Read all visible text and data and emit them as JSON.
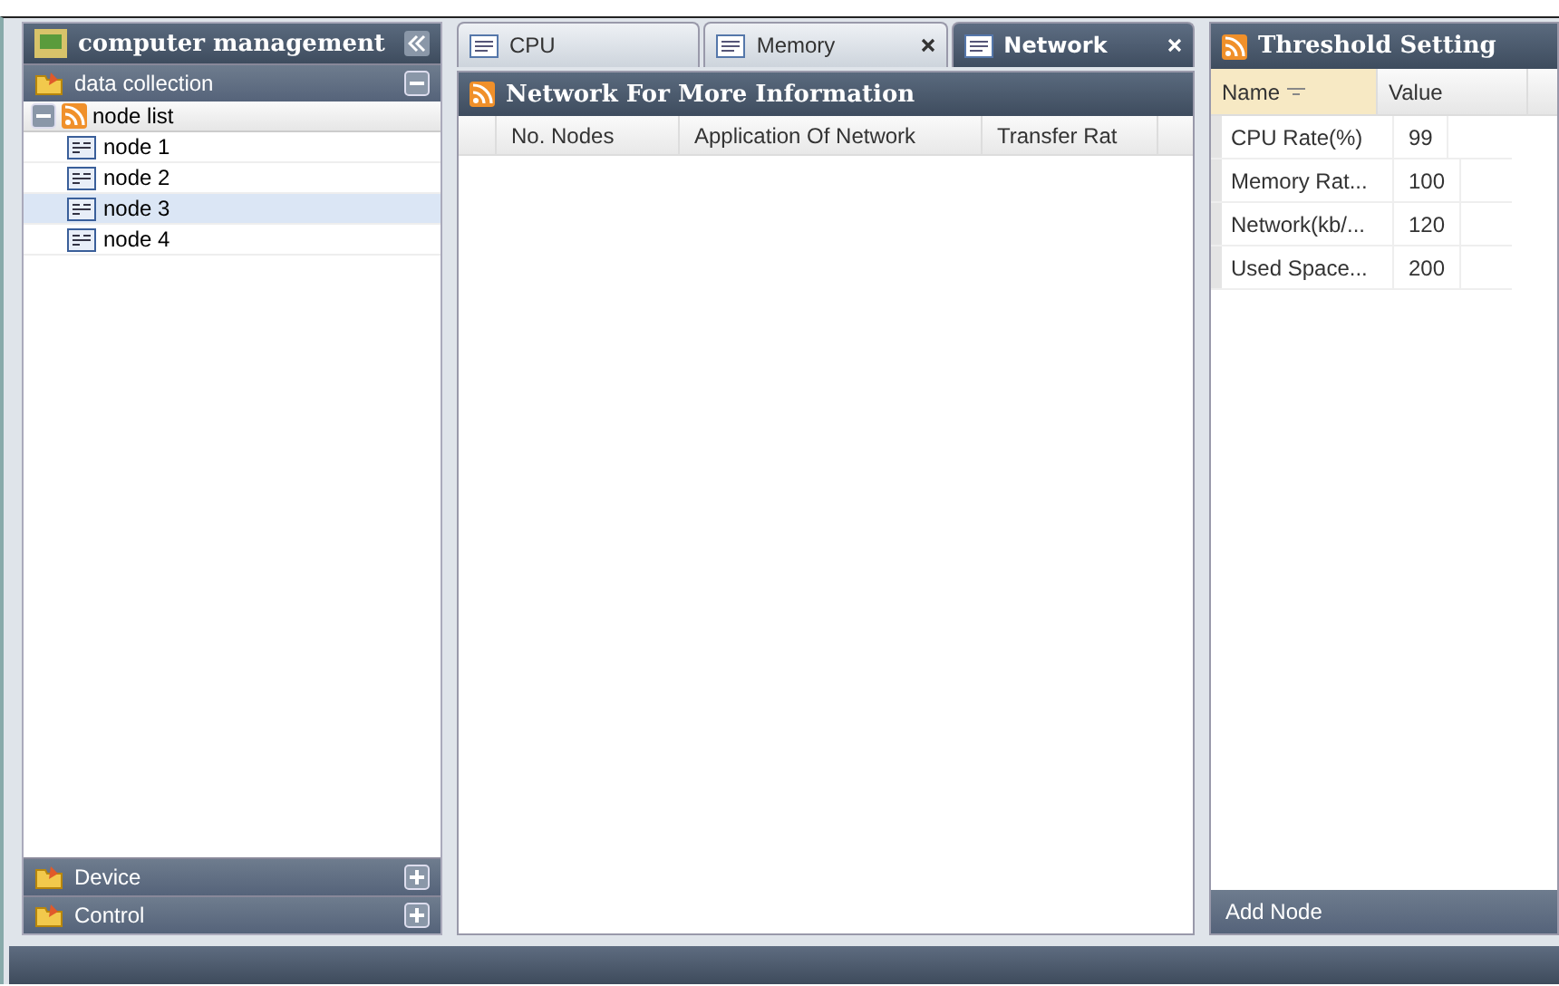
{
  "left_panel": {
    "title": "computer management",
    "sections": [
      {
        "label": "data collection",
        "expanded": true
      },
      {
        "label": "Device",
        "expanded": false
      },
      {
        "label": "Control",
        "expanded": false
      }
    ],
    "tree": {
      "label": "node list",
      "expanded": true,
      "children": [
        {
          "label": "node 1",
          "selected": false
        },
        {
          "label": "node 2",
          "selected": false
        },
        {
          "label": "node 3",
          "selected": true
        },
        {
          "label": "node 4",
          "selected": false
        }
      ]
    }
  },
  "tabs": [
    {
      "label": "CPU",
      "selected": false,
      "closable": false
    },
    {
      "label": "Memory",
      "selected": false,
      "closable": true
    },
    {
      "label": "Network",
      "selected": true,
      "closable": true
    }
  ],
  "main_panel": {
    "title": "Network For More Information",
    "columns": [
      "No. Nodes",
      "Application Of Network",
      "Transfer Rat"
    ]
  },
  "threshold_panel": {
    "title": "Threshold Setting",
    "columns": [
      {
        "label": "Name",
        "sorted": true
      },
      {
        "label": "Value",
        "sorted": false
      }
    ],
    "rows": [
      {
        "name": "CPU Rate(%)",
        "value": "99"
      },
      {
        "name": "Memory Rat...",
        "value": "100"
      },
      {
        "name": "Network(kb/...",
        "value": "120"
      },
      {
        "name": "Used Space...",
        "value": "200"
      }
    ],
    "footer": "Add Node"
  }
}
